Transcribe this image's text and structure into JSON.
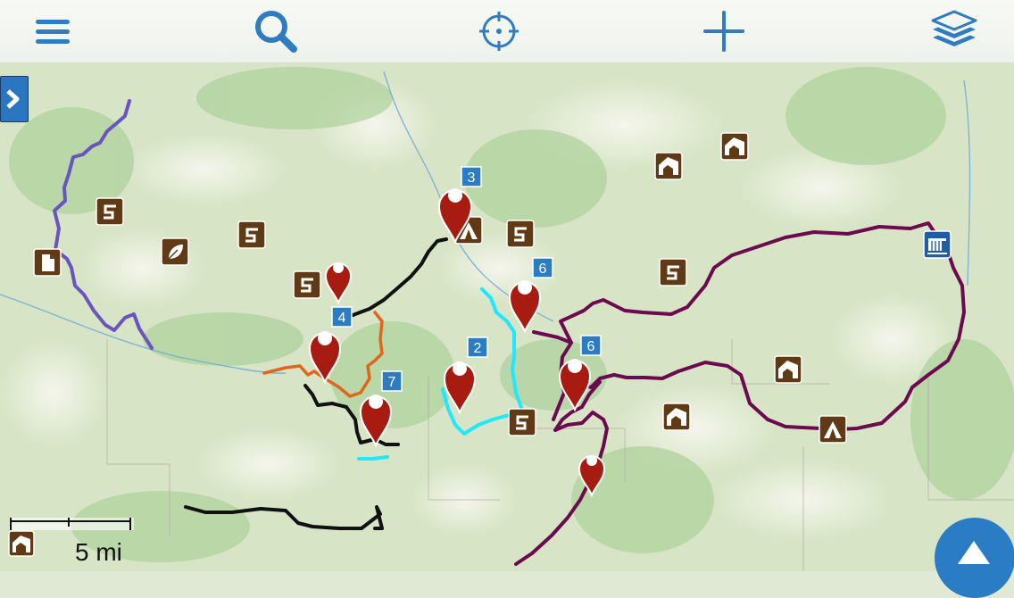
{
  "toolbar": {
    "buttons": [
      {
        "icon": "menu-icon"
      },
      {
        "icon": "search-icon"
      },
      {
        "icon": "locate-icon"
      },
      {
        "icon": "add-icon"
      },
      {
        "icon": "layers-icon"
      }
    ],
    "accent_color": "#2f7cc0"
  },
  "map": {
    "waypoint_badges": [
      "3",
      "4",
      "7",
      "2",
      "6",
      "6"
    ],
    "scale_bar": {
      "label": "5 mi"
    },
    "poi_icons": [
      "road-icon",
      "campground-icon",
      "waterfall-icon",
      "shelter-icon",
      "nature-icon",
      "document-icon"
    ],
    "track_colors": {
      "purple": "#6a55c0",
      "plum": "#6b0a4f",
      "black": "#111111",
      "orange": "#e0661c",
      "cyan": "#1fe8ff"
    },
    "marker_color": "#a71b10"
  }
}
